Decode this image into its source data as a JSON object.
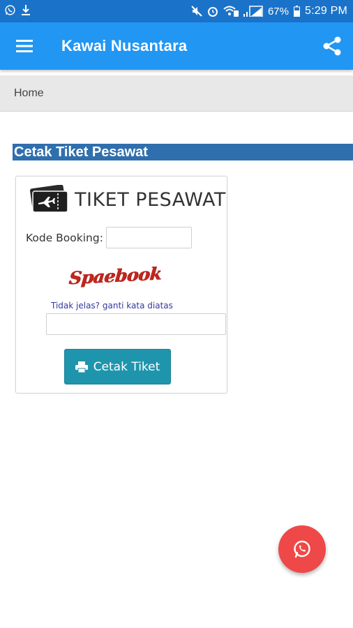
{
  "status_bar": {
    "battery": "67%",
    "time": "5:29 PM",
    "icons": [
      "whatsapp-icon",
      "download-icon",
      "mute-icon",
      "alarm-icon",
      "wifi-icon",
      "signal-icon",
      "battery-icon"
    ]
  },
  "app_bar": {
    "title": "Kawai Nusantara",
    "color": "#2196f3"
  },
  "breadcrumb": {
    "items": [
      "Home"
    ]
  },
  "page": {
    "heading": "Cetak Tiket Pesawat"
  },
  "ticket_form": {
    "title": "TIKET PESAWAT",
    "booking_label": "Kode Booking:",
    "booking_value": "",
    "captcha_text": "Spaebook",
    "captcha_refresh": "Tidak jelas? ganti kata diatas",
    "captcha_value": "",
    "submit_label": "Cetak Tiket",
    "submit_color": "#1f95ad"
  },
  "fab": {
    "icon": "whatsapp-icon",
    "color": "#ef4848"
  }
}
